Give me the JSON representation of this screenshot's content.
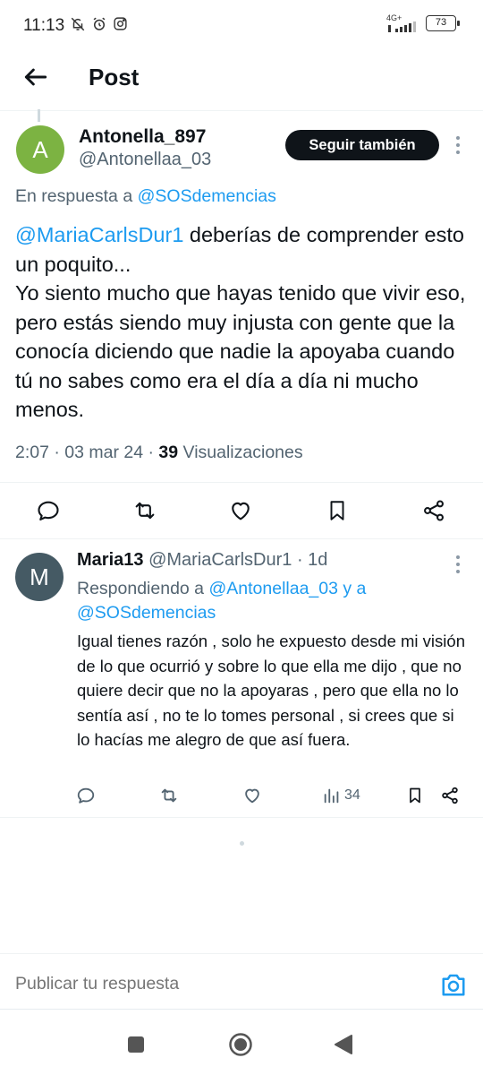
{
  "status_bar": {
    "time": "11:13",
    "network": "4G+",
    "battery": "73"
  },
  "header": {
    "title": "Post"
  },
  "main_tweet": {
    "avatar_letter": "A",
    "avatar_color": "#7cb342",
    "display_name": "Antonella_897",
    "handle": "@Antonellaa_03",
    "follow_label": "Seguir también",
    "reply_prefix": "En respuesta a",
    "reply_to": "@SOSdemencias",
    "mention": "@MariaCarlsDur1",
    "text": " deberías de comprender esto un poquito...\nYo siento mucho que hayas tenido que vivir eso, pero estás siendo muy injusta con gente que la conocía diciendo que nadie la apoyaba cuando tú no sabes como era el día a día ni mucho menos.",
    "meta_time": "2:07 · 03 mar 24 ·",
    "views_count": "39",
    "views_label": "Visualizaciones",
    "actions": [
      "reply-icon",
      "retweet-icon",
      "like-icon",
      "bookmark-icon",
      "share-icon"
    ]
  },
  "reply_tweet": {
    "avatar_letter": "M",
    "avatar_color": "#455a64",
    "display_name": "Maria13",
    "handle_time": "@MariaCarlsDur1 · 1d",
    "replying_prefix": "Respondiendo a",
    "replying_users": "@Antonellaa_03 y a @SOSdemencias",
    "text": "Igual tienes razón , solo he expuesto desde mi visión de lo que ocurrió y sobre lo que ella me dijo , que no quiere decir que no la apoyaras , pero que ella no lo sentía así , no te lo tomes personal , si crees que si lo hacías me alegro de que así fuera.",
    "views": "34"
  },
  "composer": {
    "placeholder": "Publicar tu respuesta"
  },
  "colors": {
    "link": "#1d9bf0",
    "text": "#0f1419",
    "secondary": "#536471"
  }
}
